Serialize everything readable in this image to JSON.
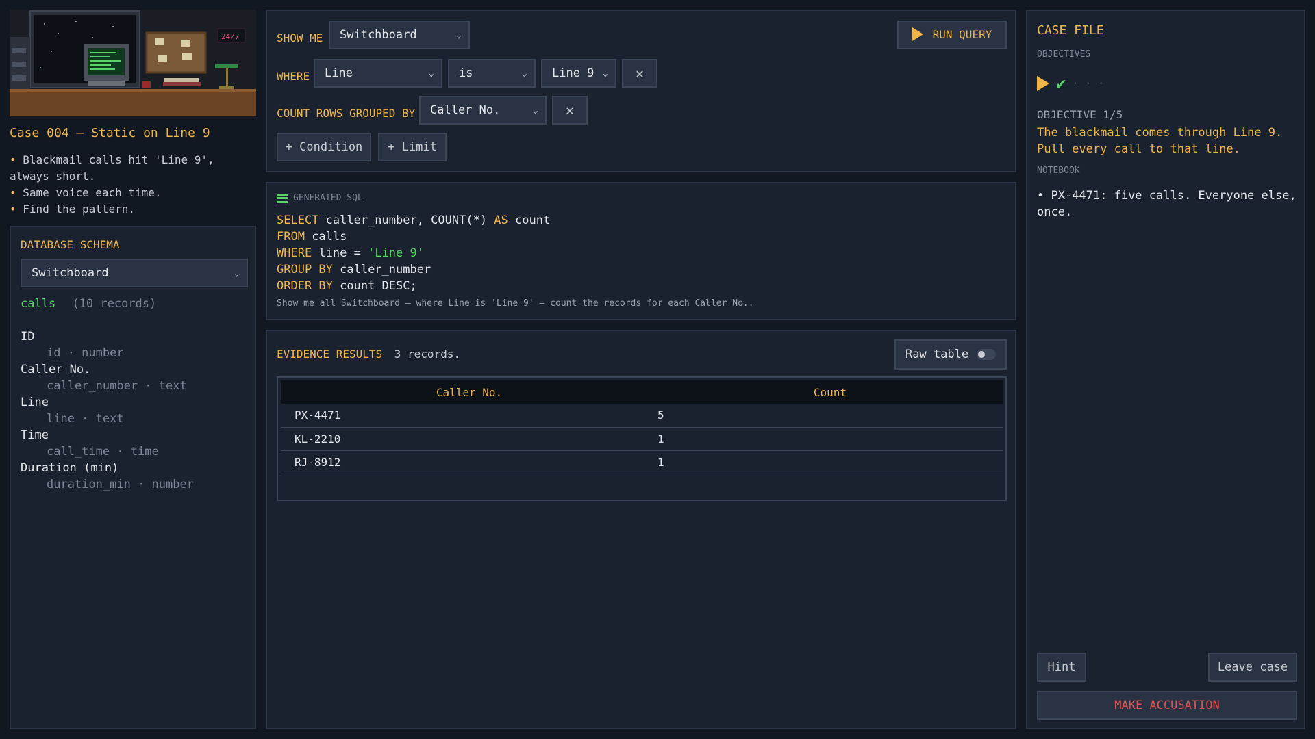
{
  "scene": {
    "clock": "24/7"
  },
  "case": {
    "title": "Case 004 — Static on Line 9",
    "brief": [
      "Blackmail calls hit 'Line 9', always short.",
      "Same voice each time.",
      "Find the pattern."
    ]
  },
  "schema": {
    "heading": "DATABASE SCHEMA",
    "selected": "Switchboard",
    "table_name": "calls",
    "table_count": "(10 records)",
    "fields": [
      {
        "label": "ID",
        "sub": "id · number"
      },
      {
        "label": "Caller No.",
        "sub": "caller_number · text"
      },
      {
        "label": "Line",
        "sub": "line · text"
      },
      {
        "label": "Time",
        "sub": "call_time · time"
      },
      {
        "label": "Duration (min)",
        "sub": "duration_min · number"
      }
    ]
  },
  "builder": {
    "show_me_label": "SHOW ME",
    "show_me_value": "Switchboard",
    "run_label": "RUN QUERY",
    "where_label": "WHERE",
    "where_field": "Line",
    "where_op": "is",
    "where_value": "Line 9",
    "group_label": "COUNT ROWS GROUPED BY",
    "group_value": "Caller No.",
    "add_condition": "+ Condition",
    "add_limit": "+ Limit"
  },
  "sql": {
    "heading": "GENERATED SQL",
    "line1_kw": "SELECT",
    "line1_rest": " caller_number, COUNT(*) ",
    "line1_kw2": "AS",
    "line1_tail": " count",
    "line2_kw": "FROM",
    "line2_rest": " calls",
    "line3_kw": "WHERE",
    "line3_rest": " line = ",
    "line3_str": "'Line 9'",
    "line4_kw": "GROUP BY",
    "line4_rest": " caller_number",
    "line5_kw": "ORDER BY",
    "line5_rest": " count DESC;",
    "description": "Show me all Switchboard — where Line is 'Line 9' — count the records for each Caller No.."
  },
  "results": {
    "title": "EVIDENCE RESULTS",
    "count": "3 records.",
    "raw_table_label": "Raw table",
    "raw_table_on": false,
    "columns": [
      "Caller No.",
      "Count"
    ],
    "rows": [
      [
        "PX-4471",
        "5"
      ],
      [
        "KL-2210",
        "1"
      ],
      [
        "RJ-8912",
        "1"
      ]
    ]
  },
  "casefile": {
    "title": "CASE FILE",
    "objectives_head": "OBJECTIVES",
    "objective_num": "OBJECTIVE 1/5",
    "objective_text": "The blackmail comes through Line 9. Pull every call to that line.",
    "notebook_head": "NOTEBOOK",
    "note": "PX-4471: five calls. Everyone else, once.",
    "hint_label": "Hint",
    "leave_label": "Leave case",
    "accuse_label": "MAKE ACCUSATION"
  },
  "colors": {
    "accent": "#f0b64a",
    "success": "#59d36a",
    "danger": "#e05050",
    "panel": "#1a2230"
  }
}
